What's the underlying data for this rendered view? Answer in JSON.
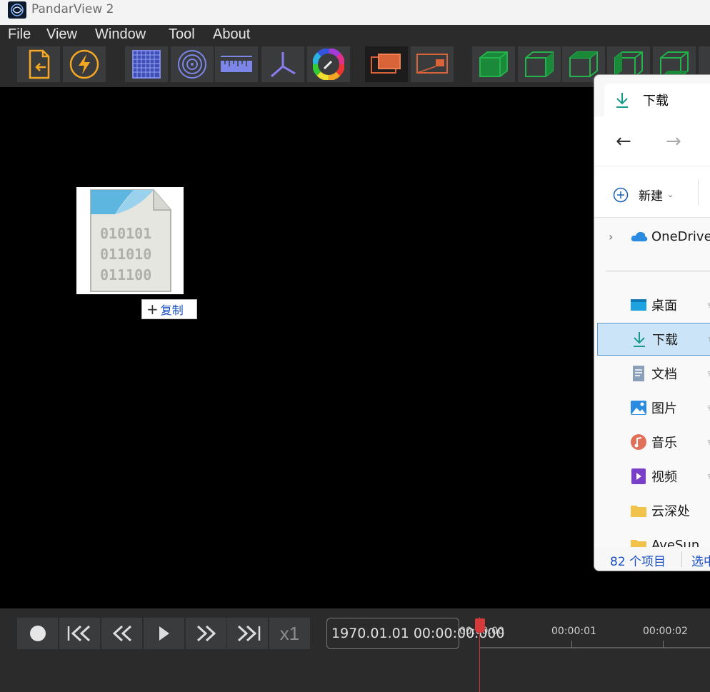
{
  "app": {
    "title": "PandarView 2"
  },
  "menu": [
    "File",
    "View",
    "Window",
    "Tool",
    "About"
  ],
  "toolbar": {
    "buttons": [
      "open-file-icon",
      "lightning-icon",
      "grid-icon",
      "radar-rings-icon",
      "ruler-icon",
      "axes-icon",
      "color-wheel-icon",
      "layer-front-icon",
      "layer-back-icon",
      "cube-view-1-icon",
      "cube-view-2-icon",
      "cube-view-3-icon",
      "cube-view-4-icon",
      "cube-view-5-icon"
    ]
  },
  "drag": {
    "copy_label": "复制",
    "binary_lines": [
      "010101",
      "011010",
      "011100"
    ]
  },
  "explorer": {
    "tab_title": "下载",
    "new_button": "新建",
    "onedrive": "OneDrive",
    "items": [
      {
        "label": "桌面",
        "icon": "desktop-icon"
      },
      {
        "label": "下载",
        "icon": "download-icon",
        "selected": true
      },
      {
        "label": "文档",
        "icon": "document-icon"
      },
      {
        "label": "图片",
        "icon": "picture-icon"
      },
      {
        "label": "音乐",
        "icon": "music-icon"
      },
      {
        "label": "视频",
        "icon": "video-icon"
      },
      {
        "label": "云深处",
        "icon": "folder-icon"
      },
      {
        "label": "AveSun",
        "icon": "folder-icon"
      }
    ],
    "status_count": "82 个项目",
    "status_selected": "选中"
  },
  "player": {
    "speed": "x1",
    "timestamp": "1970.01.01 00:00:00.000",
    "ticks": [
      "00:00:00",
      "00:00:01",
      "00:00:02"
    ]
  },
  "colors": {
    "cube_green": "#22b34a",
    "accent_orange": "#f5a623",
    "playhead_red": "#d43a3a"
  }
}
